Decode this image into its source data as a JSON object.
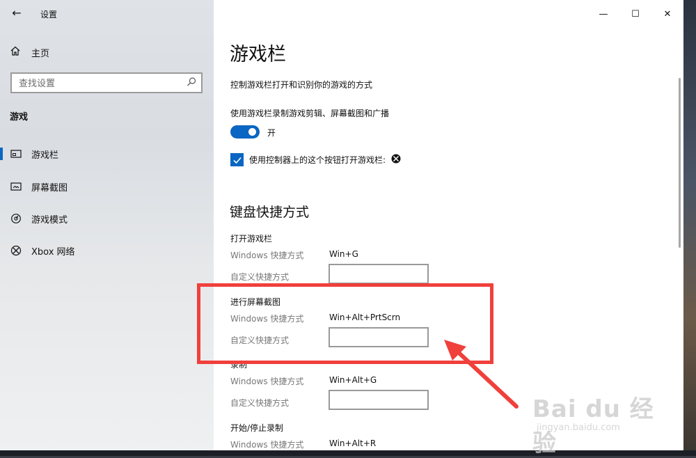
{
  "window": {
    "app_title": "设置",
    "back_icon": "back-arrow-icon",
    "caption": {
      "minimize": "—",
      "maximize": "☐",
      "close": "✕"
    }
  },
  "sidebar": {
    "home_label": "主页",
    "search_placeholder": "查找设置",
    "section": "游戏",
    "items": [
      {
        "label": "游戏栏",
        "icon": "game-bar-icon",
        "active": true
      },
      {
        "label": "屏幕截图",
        "icon": "screenshot-icon",
        "active": false
      },
      {
        "label": "游戏模式",
        "icon": "game-mode-icon",
        "active": false
      },
      {
        "label": "Xbox 网络",
        "icon": "xbox-icon",
        "active": false
      }
    ]
  },
  "main": {
    "title": "游戏栏",
    "description": "控制游戏栏打开和识别你的游戏的方式",
    "toggle_label": "使用游戏栏录制游戏剪辑、屏幕截图和广播",
    "toggle_state": "开",
    "toggle_on": true,
    "checkbox_label": "使用控制器上的这个按钮打开游戏栏:",
    "checkbox_checked": true,
    "keyboard_title": "键盘快捷方式",
    "shortcut_label": "Windows 快捷方式",
    "custom_label": "自定义快捷方式",
    "groups": [
      {
        "title": "打开游戏栏",
        "shortcut": "Win+G"
      },
      {
        "title": "进行屏幕截图",
        "shortcut": "Win+Alt+PrtScrn"
      },
      {
        "title": "录制",
        "shortcut": "Win+Alt+G"
      },
      {
        "title": "开始/停止录制",
        "shortcut": "Win+Alt+R"
      }
    ]
  },
  "annotation": {
    "highlight_color": "#f0403c",
    "accent_color": "#0a66c2"
  },
  "watermark": {
    "main": "Bai du 经验",
    "sub": "jingyan.baidu.com"
  }
}
